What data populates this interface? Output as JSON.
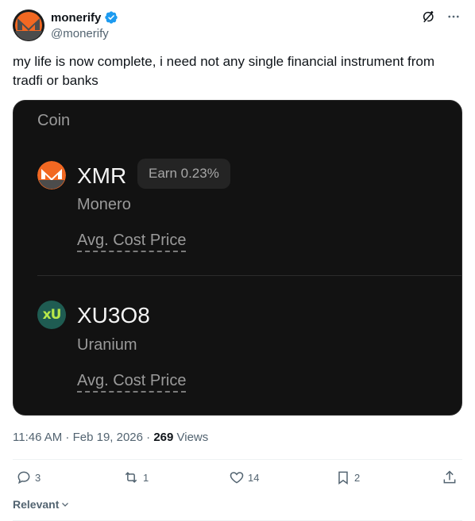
{
  "author": {
    "name": "monerify",
    "handle": "@monerify"
  },
  "tweet": {
    "text": "my life is now complete, i need not any single financial instrument from tradfi or banks"
  },
  "card": {
    "header": "Coin",
    "coins": [
      {
        "ticker": "XMR",
        "badge": "Earn 0.23%",
        "name": "Monero",
        "avg_label": "Avg. Cost Price",
        "logo_text": "M"
      },
      {
        "ticker": "XU3O8",
        "name": "Uranium",
        "avg_label": "Avg. Cost Price",
        "logo_text": "xU"
      }
    ]
  },
  "meta": {
    "time": "11:46 AM · Feb 19, 2026 · ",
    "views_count": "269",
    "views_label": " Views"
  },
  "actions": {
    "replies": "3",
    "reposts": "1",
    "likes": "14",
    "bookmarks": "2"
  },
  "sort": {
    "label": "Relevant"
  },
  "colors": {
    "verified": "#1d9bf0",
    "monero_orange": "#f26822",
    "uranium_green": "#b7e84a",
    "card_bg": "#121212"
  }
}
